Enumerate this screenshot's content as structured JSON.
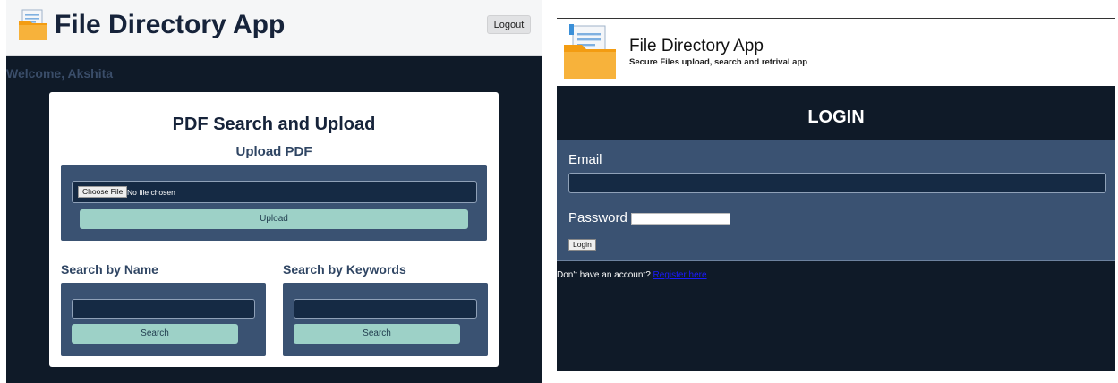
{
  "left": {
    "app_title": "File Directory App",
    "logout_label": "Logout",
    "welcome": "Welcome, Akshita",
    "card_title": "PDF Search and Upload",
    "upload_heading": "Upload PDF",
    "choose_file_label": "Choose File",
    "file_status": "No file chosen",
    "upload_label": "Upload",
    "search_name_heading": "Search by Name",
    "search_keywords_heading": "Search by Keywords",
    "search_label": "Search"
  },
  "right": {
    "app_title": "File Directory App",
    "subtitle": "Secure Files upload, search and retrival app",
    "login_heading": "LOGIN",
    "email_label": "Email",
    "password_label": "Password",
    "login_label": "Login",
    "register_prompt": "Don't have an account?",
    "register_link": "Register here"
  },
  "icons": {
    "logo": "folder-document-icon"
  },
  "colors": {
    "dark_bg": "#0f1a28",
    "panel_bg": "#3a5272",
    "button_accent": "#9dd1c7",
    "input_bg": "#152a44",
    "folder_yellow": "#f7b23b",
    "folder_orange": "#f39c12",
    "link": "#1a1aff"
  }
}
